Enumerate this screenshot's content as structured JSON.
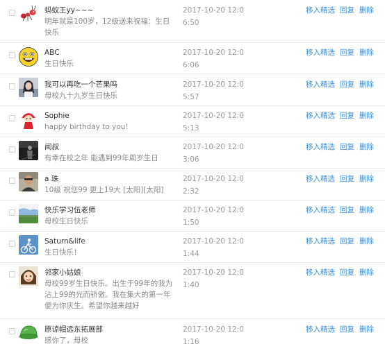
{
  "actions": {
    "feature": "移入精选",
    "reply": "回复",
    "delete": "删除"
  },
  "comments": [
    {
      "user": "蚂蚁王yy~~~",
      "message": "明年就是100岁，12级送来祝福：生日快乐",
      "time": "2017-10-20 12:06:50",
      "avatar_icon": "ant-icon"
    },
    {
      "user": "ABC",
      "message": "生日快乐",
      "time": "2017-10-20 12:06:06",
      "avatar_icon": "laughing-face-icon"
    },
    {
      "user": "我可以再吃一个芒果吗",
      "message": "母校九十九岁生日快乐",
      "time": "2017-10-20 12:05:57",
      "avatar_icon": "girl-portrait-icon"
    },
    {
      "user": "Sophie",
      "message": "happy birthday to you!",
      "time": "2017-10-20 12:05:13",
      "avatar_icon": "red-hat-girl-icon"
    },
    {
      "user": "闻叔",
      "message": "有幸在校之年 能遇到99年周岁生日",
      "time": "2017-10-20 12:03:06",
      "avatar_icon": "dark-figure-icon"
    },
    {
      "user": "a 珠",
      "message": "10级 祝您99 更上19大 [太阳][太阳]",
      "time": "2017-10-20 12:02:32",
      "avatar_icon": "person-photo-icon"
    },
    {
      "user": "快乐学习伍老师",
      "message": "母校生日快乐",
      "time": "2017-10-20 12:01:50",
      "avatar_icon": "landscape-icon"
    },
    {
      "user": "Saturn&life",
      "message": "生日快乐！",
      "time": "2017-10-20 12:01:44",
      "avatar_icon": "cyclist-icon"
    },
    {
      "user": "邻家小姑娘",
      "message": "母校99岁生日快乐。出生于99年的我为沾上99的光而骄傲。我在集大的第一年便为你庆生。希望你越来越好",
      "time": "2017-10-20 12:01:40",
      "avatar_icon": "cartoon-girl-icon"
    },
    {
      "user": "原谅帽远东拓展部",
      "message": "感你了，母校",
      "time": "2017-10-20 12:01:16",
      "avatar_icon": "green-hat-icon"
    }
  ]
}
